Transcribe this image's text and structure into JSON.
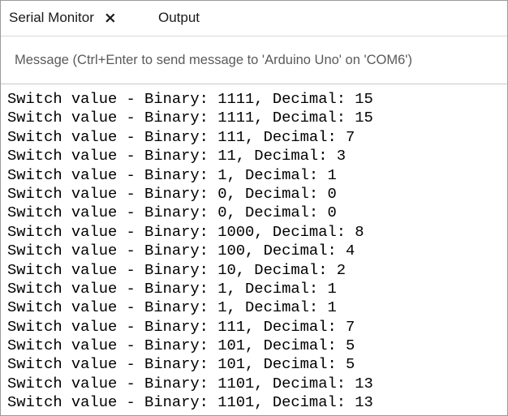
{
  "tabs": {
    "serial_monitor_label": "Serial Monitor",
    "close_glyph": "×",
    "output_label": "Output"
  },
  "message": {
    "placeholder": "Message (Ctrl+Enter to send message to 'Arduino Uno' on 'COM6')",
    "value": ""
  },
  "output": {
    "lines": [
      "Switch value - Binary: 1111, Decimal: 15",
      "Switch value - Binary: 1111, Decimal: 15",
      "Switch value - Binary: 111, Decimal: 7",
      "Switch value - Binary: 11, Decimal: 3",
      "Switch value - Binary: 1, Decimal: 1",
      "Switch value - Binary: 0, Decimal: 0",
      "Switch value - Binary: 0, Decimal: 0",
      "Switch value - Binary: 1000, Decimal: 8",
      "Switch value - Binary: 100, Decimal: 4",
      "Switch value - Binary: 10, Decimal: 2",
      "Switch value - Binary: 1, Decimal: 1",
      "Switch value - Binary: 1, Decimal: 1",
      "Switch value - Binary: 111, Decimal: 7",
      "Switch value - Binary: 101, Decimal: 5",
      "Switch value - Binary: 101, Decimal: 5",
      "Switch value - Binary: 1101, Decimal: 13",
      "Switch value - Binary: 1101, Decimal: 13"
    ]
  }
}
